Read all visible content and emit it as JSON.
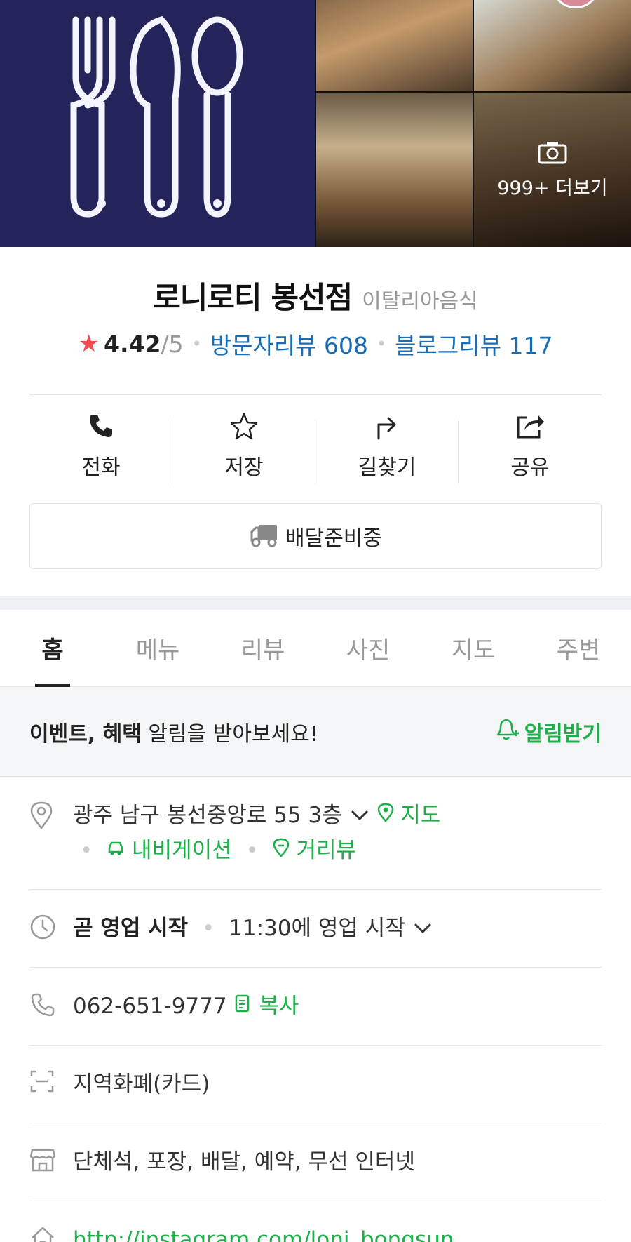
{
  "photos": {
    "more_label": "999+ 더보기"
  },
  "place": {
    "name": "로니로티 봉선점",
    "category": "이탈리아음식",
    "score": "4.42",
    "max": "/5",
    "visitor_reviews": "방문자리뷰 608",
    "blog_reviews": "블로그리뷰 117"
  },
  "actions": [
    {
      "label": "전화",
      "icon": "phone-icon"
    },
    {
      "label": "저장",
      "icon": "star-outline-icon"
    },
    {
      "label": "길찾기",
      "icon": "directions-icon"
    },
    {
      "label": "공유",
      "icon": "share-icon"
    }
  ],
  "delivery": {
    "label": "배달준비중",
    "icon": "delivery-truck-icon"
  },
  "tabs": [
    "홈",
    "메뉴",
    "리뷰",
    "사진",
    "지도",
    "주변"
  ],
  "event": {
    "bold": "이벤트, 혜택",
    "text": " 알림을 받아보세요!",
    "button": "알림받기"
  },
  "info": {
    "address": "광주 남구 봉선중앙로 55 3층",
    "map_label": "지도",
    "navi_label": "내비게이션",
    "street_label": "거리뷰",
    "hours_status": "곧 영업 시작",
    "hours_detail": "11:30에 영업 시작",
    "phone": "062-651-9777",
    "copy_label": "복사",
    "payment": "지역화폐(카드)",
    "facilities": "단체석, 포장, 배달, 예약, 무선 인터넷",
    "website": "http://instagram.com/loni_bongsun"
  },
  "colors": {
    "accent_green": "#1db04a",
    "link_blue": "#1a6cb5",
    "star_red": "#f2484f"
  }
}
